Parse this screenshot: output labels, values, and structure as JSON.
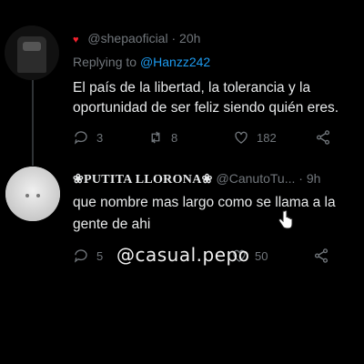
{
  "tweet1": {
    "handle": "@shepaoficial",
    "separator": "·",
    "time": "20h",
    "reply_prefix": "Replying to",
    "reply_to": "@Hanzz242",
    "text_line1": "El país de la libertad, la tolerancia y la",
    "text_line2": "oportunidad de ser feliz siendo quién eres.",
    "replies": "3",
    "retweets": "8",
    "likes": "182"
  },
  "tweet2": {
    "display_name": "❀PUTITA LLORONA❀",
    "handle": "@CanutoTu...",
    "separator": "·",
    "time": "9h",
    "text_line1": "que nombre mas largo como se llama  a la",
    "text_line2": "gente de ahi",
    "replies": "5",
    "likes": "50"
  },
  "watermark": "@casual.pepo",
  "colors": {
    "background": "#000000",
    "text": "#e7e9ea",
    "muted": "#71767b",
    "link": "#1d9bf0"
  },
  "icons": [
    "reply-icon",
    "retweet-icon",
    "like-icon",
    "share-icon"
  ]
}
